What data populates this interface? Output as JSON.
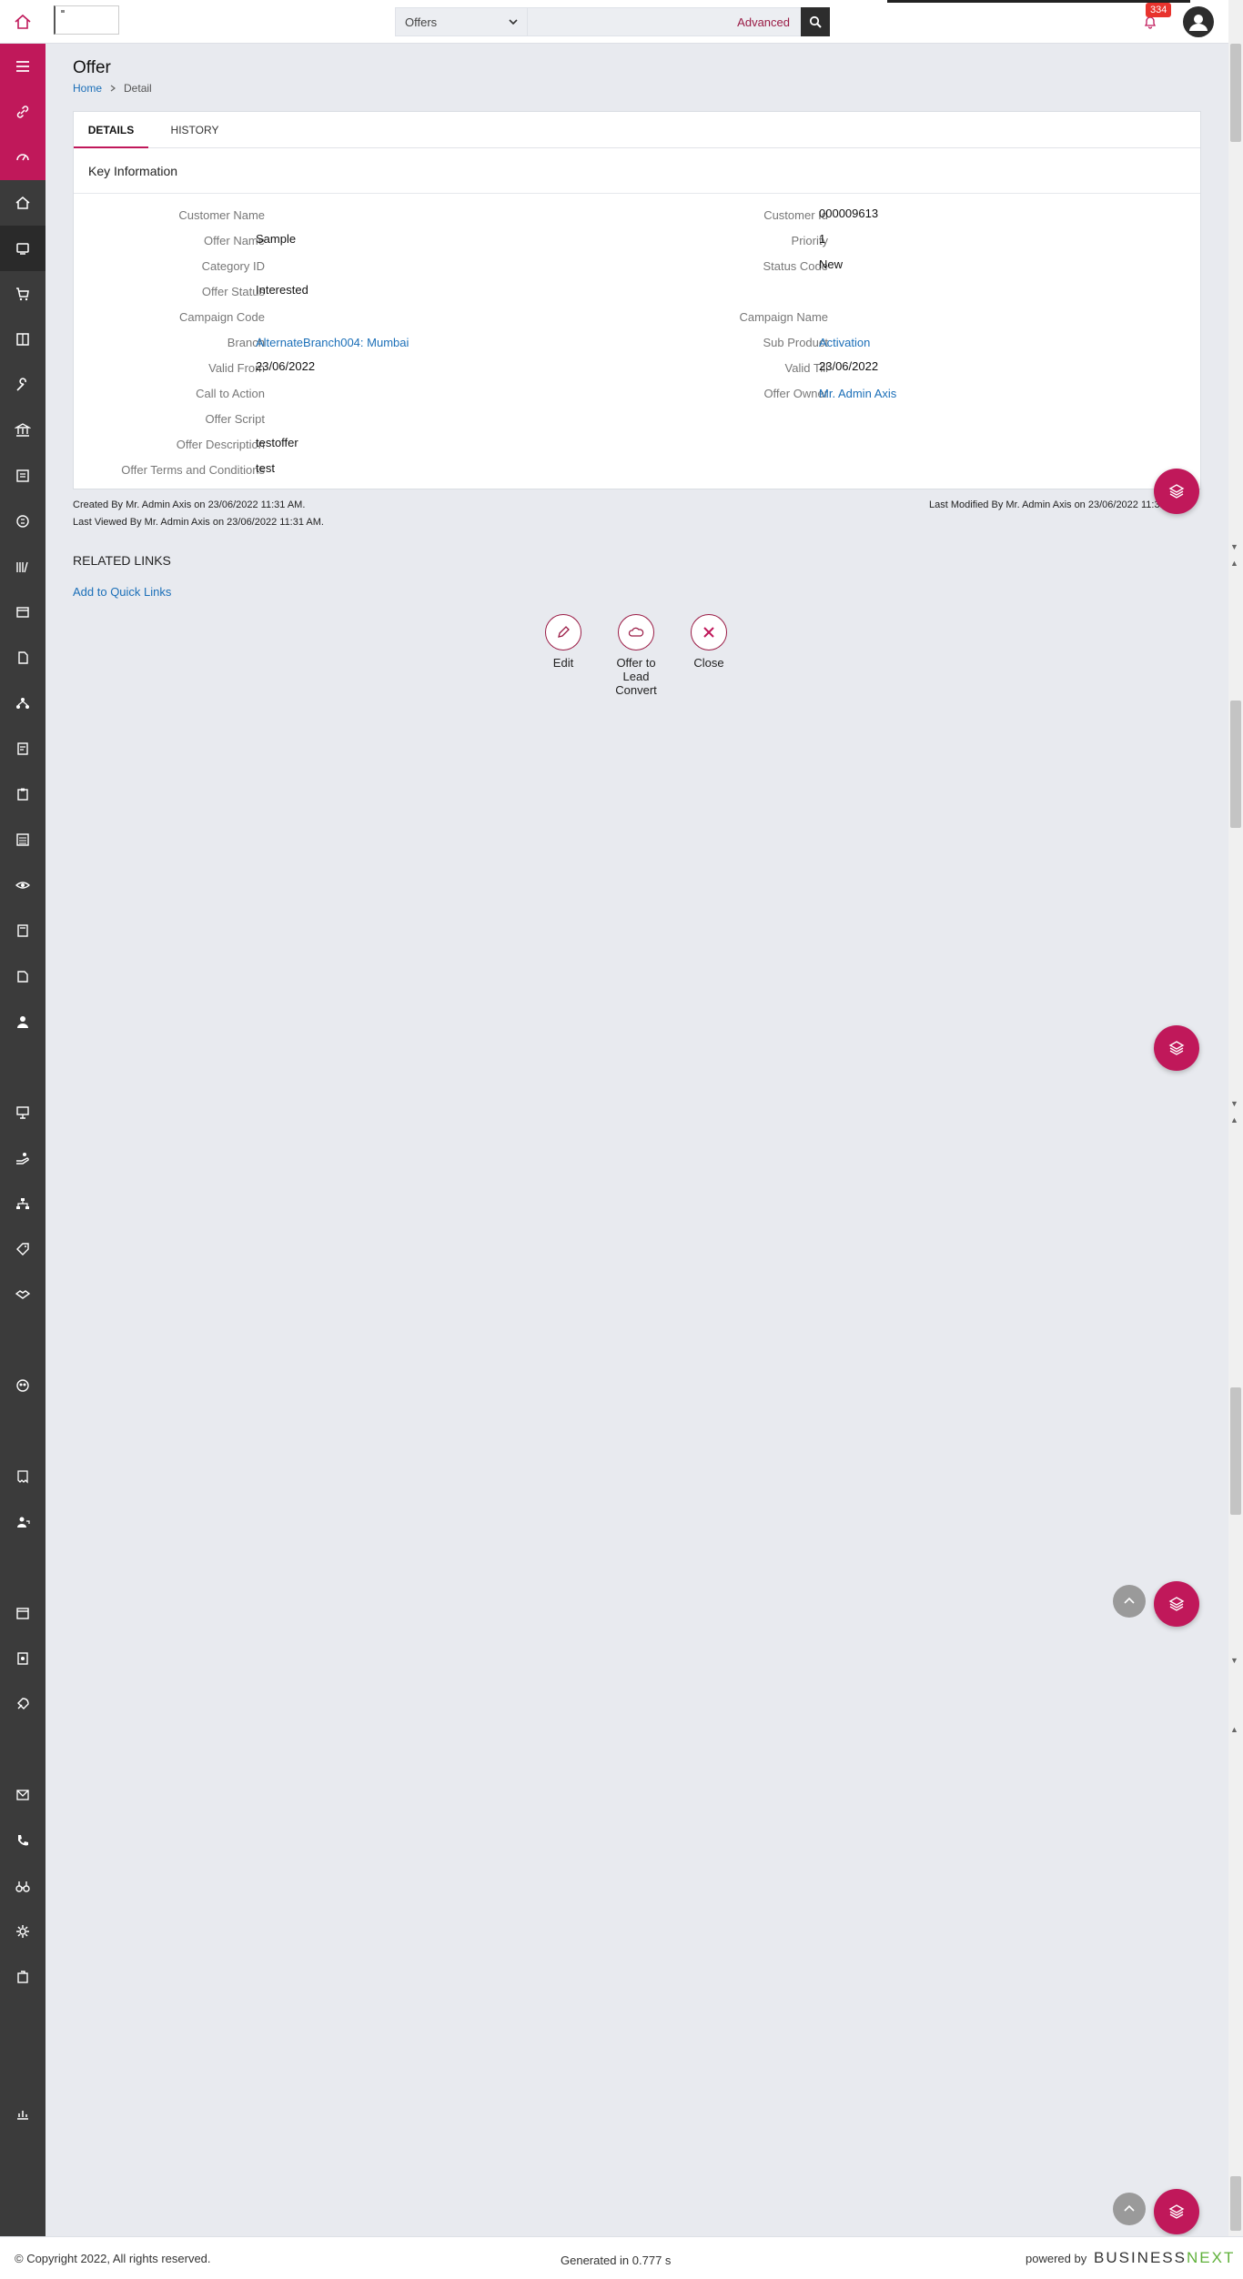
{
  "header": {
    "search_module": "Offers",
    "search_placeholder": "",
    "advanced_label": "Advanced",
    "notification_count": "334"
  },
  "page": {
    "title": "Offer",
    "breadcrumb": [
      "Home",
      "Detail"
    ]
  },
  "tabs": [
    {
      "label": "DETAILS",
      "active": true
    },
    {
      "label": "HISTORY",
      "active": false
    }
  ],
  "section": {
    "title": "Key Information"
  },
  "fields_left": [
    {
      "label": "Customer Name",
      "value": "",
      "link": false
    },
    {
      "label": "Offer Name",
      "value": "Sample",
      "link": false
    },
    {
      "label": "Category ID",
      "value": "",
      "link": false
    },
    {
      "label": "Offer Status",
      "value": "Interested",
      "link": false
    },
    {
      "label": "Campaign Code",
      "value": "",
      "link": false
    },
    {
      "label": "Branch",
      "value": "AlternateBranch004: Mumbai",
      "link": true
    },
    {
      "label": "Valid From",
      "value": "23/06/2022",
      "link": false
    },
    {
      "label": "Call to Action",
      "value": "",
      "link": false
    },
    {
      "label": "Offer Script",
      "value": "",
      "link": false
    },
    {
      "label": "Offer Description",
      "value": "testoffer",
      "link": false
    },
    {
      "label": "Offer Terms and Conditions",
      "value": "test",
      "link": false
    }
  ],
  "fields_right": [
    {
      "label": "Customer Id",
      "value": "000009613",
      "link": false
    },
    {
      "label": "Priority",
      "value": "1",
      "link": false
    },
    {
      "label": "Status Code",
      "value": "New",
      "link": false
    },
    {
      "label": "",
      "value": "",
      "link": false
    },
    {
      "label": "Campaign Name",
      "value": "",
      "link": false
    },
    {
      "label": "Sub Product",
      "value": "Activation",
      "link": true
    },
    {
      "label": "Valid Till",
      "value": "23/06/2022",
      "link": false
    },
    {
      "label": "Offer Owner",
      "value": "Mr. Admin Axis",
      "link": true
    }
  ],
  "audit": {
    "created": "Created By Mr. Admin Axis on 23/06/2022 11:31 AM.",
    "viewed": "Last Viewed By Mr. Admin Axis on 23/06/2022 11:31 AM.",
    "modified": "Last Modified By Mr. Admin Axis on 23/06/2022 11:31 AM."
  },
  "related": {
    "title": "RELATED LINKS",
    "quick_link": "Add to Quick Links"
  },
  "actions": [
    {
      "label": "Edit",
      "icon": "pencil-icon"
    },
    {
      "label": "Offer to Lead Convert",
      "icon": "cloud-icon"
    },
    {
      "label": "Close",
      "icon": "close-icon"
    }
  ],
  "footer": {
    "copyright": "© Copyright 2022, All rights reserved.",
    "generated": "Generated in 0.777 s",
    "powered_by": "powered by",
    "brand_a": "BUSINESS",
    "brand_b": "NEXT"
  },
  "colors": {
    "accent": "#c0185a",
    "link": "#1b6fb8",
    "sidebar": "#3b3b3b"
  }
}
